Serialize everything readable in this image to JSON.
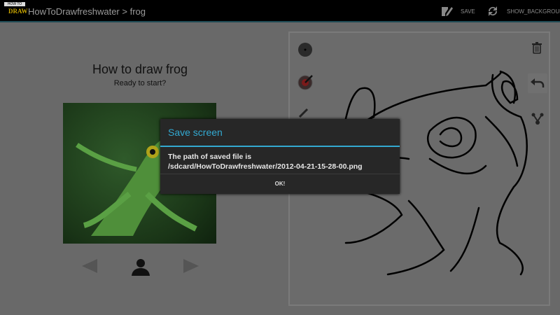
{
  "topbar": {
    "logo_text_top": "HOW TO",
    "logo_text_bottom": "DRAW",
    "breadcrumb": "HowToDrawfreshwater > frog",
    "save_label": "SAVE",
    "show_background_label": "SHOW_BACKGROUND"
  },
  "lesson": {
    "title": "How to draw frog",
    "subtitle": "Ready to start?"
  },
  "dialog": {
    "title": "Save screen",
    "message_line1": "The path of saved file is",
    "message_line2": "/sdcard/HowToDrawfreshwater/2012-04-21-15-28-00.png",
    "ok_label": "OK!"
  },
  "colors": {
    "accent": "#33a9d1",
    "dim_background": "#696969",
    "dialog_bg": "#272727"
  }
}
